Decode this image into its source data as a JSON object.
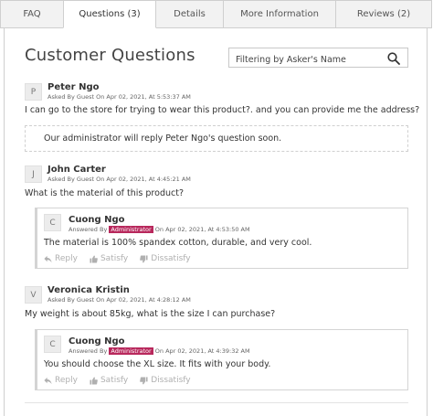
{
  "tabs": [
    {
      "label": "FAQ"
    },
    {
      "label": "Questions (3)"
    },
    {
      "label": "Details"
    },
    {
      "label": "More Information"
    },
    {
      "label": "Reviews (2)"
    }
  ],
  "heading": "Customer Questions",
  "search": {
    "placeholder": "Filtering by Asker's Name"
  },
  "questions": [
    {
      "initial": "P",
      "author": "Peter Ngo",
      "meta": "Asked By Guest On Apr 02, 2021, At 5:53:37 AM",
      "text": "I can go to the store for trying to wear this product?. and you can provide me the address?",
      "notice": "Our administrator will reply Peter Ngo's question soon."
    },
    {
      "initial": "J",
      "author": "John Carter",
      "meta": "Asked By Guest On Apr 02, 2021, At 4:45:21 AM",
      "text": "What is the material of this product?",
      "answer": {
        "initial": "C",
        "author": "Cuong Ngo",
        "answered_by": "Answered By",
        "role": "Administrator",
        "meta_rest": "On Apr 02, 2021, At 4:53:50 AM",
        "text": "The material is 100% spandex cotton, durable, and very cool."
      }
    },
    {
      "initial": "V",
      "author": "Veronica Kristin",
      "meta": "Asked By Guest On Apr 02, 2021, At 4:28:12 AM",
      "text": "My weight is about 85kg, what is the size I can purchase?",
      "answer": {
        "initial": "C",
        "author": "Cuong Ngo",
        "answered_by": "Answered By",
        "role": "Administrator",
        "meta_rest": "On Apr 02, 2021, At 4:39:32 AM",
        "text": "You should choose the XL size. It fits with your body."
      }
    }
  ],
  "actions": {
    "reply": "Reply",
    "satisfy": "Satisfy",
    "dissatisfy": "Dissatisfy"
  }
}
